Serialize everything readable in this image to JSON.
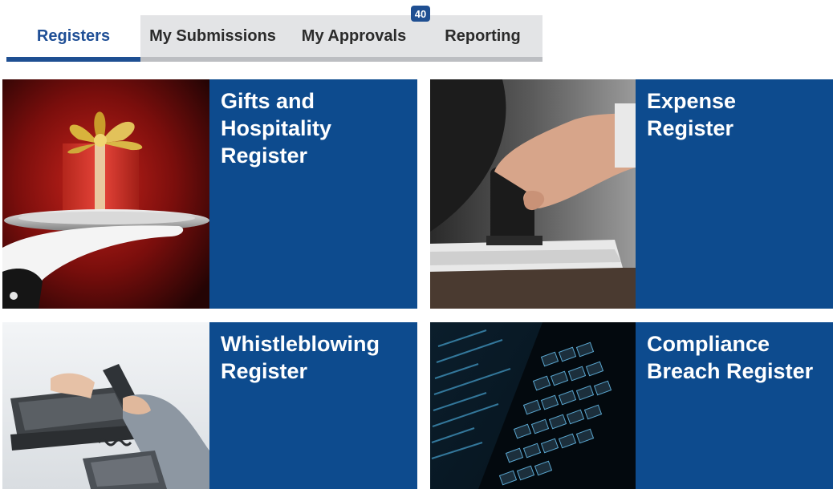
{
  "tabs": [
    {
      "label": "Registers",
      "active": true
    },
    {
      "label": "My Submissions",
      "active": false
    },
    {
      "label": "My Approvals",
      "active": false,
      "badge": "40"
    },
    {
      "label": "Reporting",
      "active": false
    }
  ],
  "tiles": [
    {
      "title": "Gifts and Hospitality Register",
      "image": "gift-on-silver-tray"
    },
    {
      "title": "Expense Register",
      "image": "hand-stamping-document"
    },
    {
      "title": "Whistleblowing Register",
      "image": "hand-lifting-phone-receiver"
    },
    {
      "title": "Compliance Breach Register",
      "image": "laptop-keyboard-with-code"
    }
  ],
  "colors": {
    "primary": "#0d4b8e",
    "tab_active_text": "#1f4f96",
    "tab_bar_bg": "#e3e4e6"
  }
}
